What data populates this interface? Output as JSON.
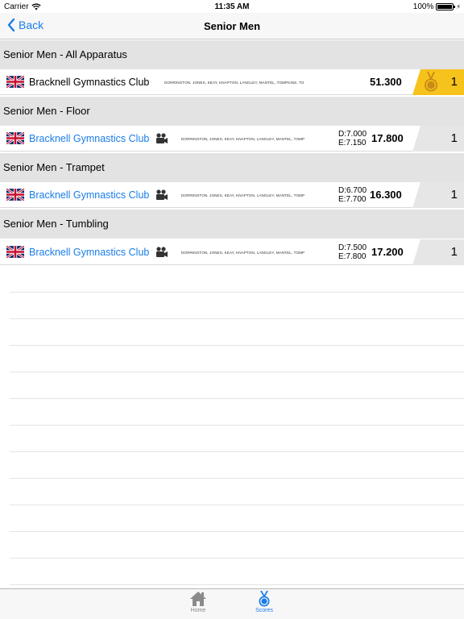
{
  "status_bar": {
    "carrier": "Carrier",
    "time": "11:35 AM",
    "battery": "100%"
  },
  "nav": {
    "back_label": "Back",
    "title": "Senior Men"
  },
  "sections": [
    {
      "title": "Senior Men - All Apparatus",
      "club": "Bracknell Gymnastics Club",
      "members": "DORRINGTON, JONES, KEAY, KNAPTON, LANGLEY, MANTEL, TOMPKINS, TO",
      "d_score": "",
      "e_score": "",
      "score": "51.300",
      "rank": "1"
    },
    {
      "title": "Senior Men - Floor",
      "club": "Bracknell Gymnastics Club",
      "members": "DORRINGTON, JONES, KEAY, KNAPTON, LANGLEY, MANTEL, TOMP",
      "d_score": "D:7.000",
      "e_score": "E:7.150",
      "score": "17.800",
      "rank": "1"
    },
    {
      "title": "Senior Men - Trampet",
      "club": "Bracknell Gymnastics Club",
      "members": "DORRINGTON, JONES, KEAY, KNAPTON, LANGLEY, MANTEL, TOMP",
      "d_score": "D:6.700",
      "e_score": "E:7.700",
      "score": "16.300",
      "rank": "1"
    },
    {
      "title": "Senior Men - Tumbling",
      "club": "Bracknell Gymnastics Club",
      "members": "DORRINGTON, JONES, KEAY, KNAPTON, LANGLEY, MANTEL, TOMP",
      "d_score": "D:7.500",
      "e_score": "E:7.800",
      "score": "17.200",
      "rank": "1"
    }
  ],
  "tabs": [
    {
      "label": "Home",
      "icon": "home-icon"
    },
    {
      "label": "Scores",
      "icon": "medal-icon"
    }
  ],
  "colors": {
    "accent": "#1a7de8",
    "gold": "#f6c21c",
    "section_bg": "#e3e3e3"
  }
}
